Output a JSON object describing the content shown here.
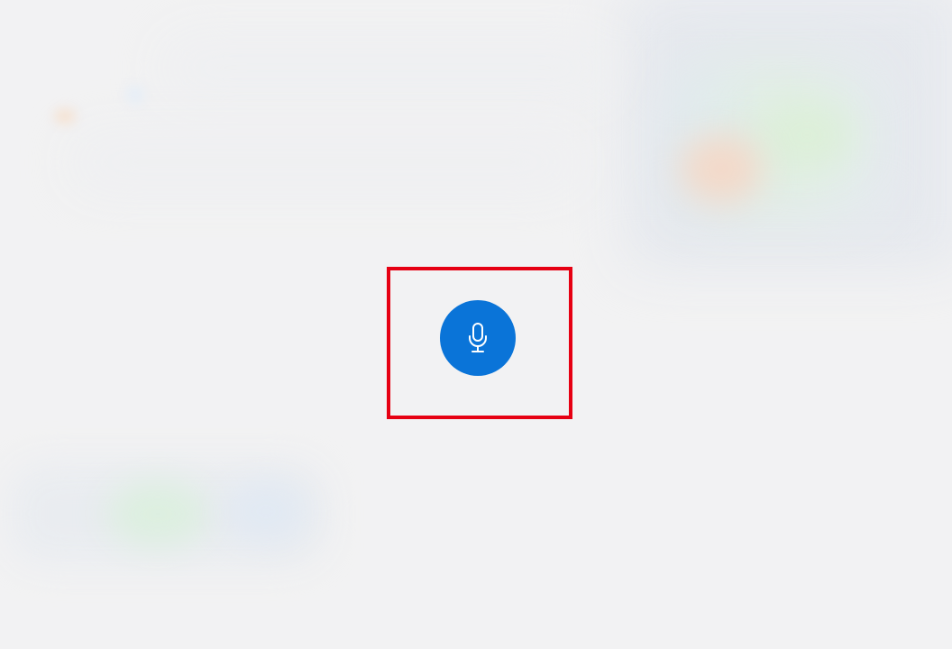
{
  "screen": {
    "background_color": "#f2f2f3"
  },
  "voice_input": {
    "button_icon": "microphone-icon",
    "button_color": "#0a74d8",
    "icon_color": "#ffffff",
    "highlight_color": "#e60012"
  }
}
